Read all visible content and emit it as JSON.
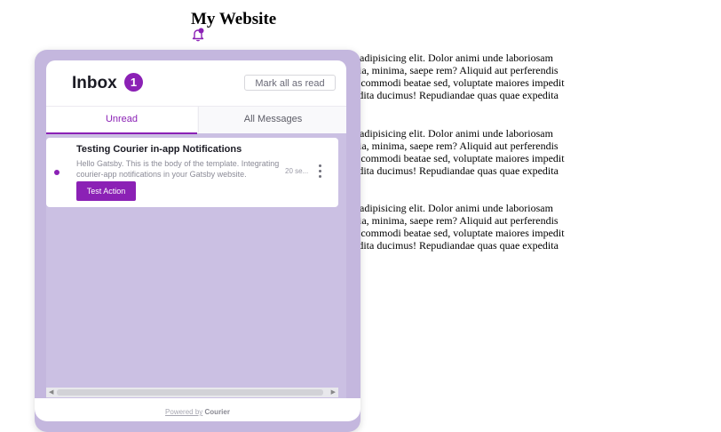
{
  "site": {
    "title": "My Website"
  },
  "paragraphs": [
    {
      "lines": [
        "r adipisicing elit. Dolor animi unde laboriosam",
        "uia, minima, saepe rem? Aliquid aut perferendis",
        "a commodi beatae sed, voluptate maiores impedit",
        "edita ducimus! Repudiandae quas quae expedita"
      ]
    },
    {
      "lines": [
        "r adipisicing elit. Dolor animi unde laboriosam",
        "uia, minima, saepe rem? Aliquid aut perferendis",
        "a commodi beatae sed, voluptate maiores impedit",
        "edita ducimus! Repudiandae quas quae expedita"
      ]
    },
    {
      "lines": [
        "r adipisicing elit. Dolor animi unde laboriosam",
        "uia, minima, saepe rem? Aliquid aut perferendis",
        "a commodi beatae sed, voluptate maiores impedit",
        "edita ducimus! Repudiandae quas quae expedita"
      ]
    }
  ],
  "inbox": {
    "title": "Inbox",
    "unread_count": "1",
    "mark_all_label": "Mark all as read",
    "tabs": [
      {
        "label": "Unread",
        "active": true
      },
      {
        "label": "All Messages",
        "active": false
      }
    ],
    "messages": [
      {
        "title": "Testing Courier in-app Notifications",
        "body_lines": [
          "Hello Gatsby. This is the body of the template. Integrating",
          "courier-app notifications in your Gatsby website."
        ],
        "time": "20 se...",
        "action_label": "Test Action",
        "icon": "more-vertical-icon"
      }
    ],
    "footer": {
      "powered_label": "Powered by",
      "brand": "Courier"
    }
  },
  "colors": {
    "accent": "#8b21b5",
    "panel_bg": "#c4b7de"
  },
  "icons": {
    "bell": "bell-icon"
  }
}
